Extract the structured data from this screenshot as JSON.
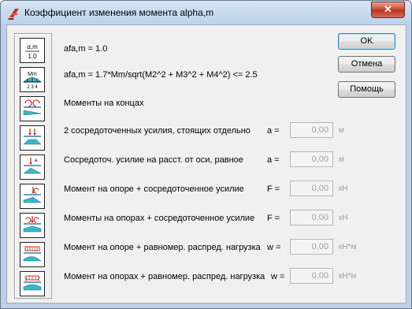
{
  "window": {
    "title": "Коэффициент изменения момента alpha,m",
    "close_label": "✕"
  },
  "formulas": {
    "f1": "afa,m = 1.0",
    "f2": "afa,m = 1.7*Mm/sqrt(M2^2 + M3^2 + M4^2) <= 2.5"
  },
  "icon_texts": {
    "alpha_top": "α,m",
    "alpha_bottom": "1.0",
    "mm_top": "Mm",
    "mm_bottom": "2 3 4"
  },
  "rows": [
    {
      "label": "Моменты на концах"
    },
    {
      "label": "2 сосредоточенных усилия, стоящих отдельно",
      "var": "a =",
      "value": "0,00",
      "unit": "м"
    },
    {
      "label": "Сосредоточ. усилие на расст. от оси, равное",
      "var": "a =",
      "value": "0,00",
      "unit": "м"
    },
    {
      "label": "Момент на опоре + сосредоточенное усилие",
      "var": "F =",
      "value": "0,00",
      "unit": "кН"
    },
    {
      "label": "Моменты на опорах + сосредоточенное усилие",
      "var": "F =",
      "value": "0,00",
      "unit": "кН"
    },
    {
      "label": "Момент на опоре + равномер. распред. нагрузка",
      "var": "w =",
      "value": "0,00",
      "unit": "кН*м"
    },
    {
      "label": "Момент на опорах + равномер. распред. нагрузка",
      "var": "w =",
      "value": "0,00",
      "unit": "кН*м"
    }
  ],
  "buttons": {
    "ok": "OK",
    "cancel": "Отмена",
    "help": "Помощь"
  },
  "colors": {
    "icon_red": "#c0392b",
    "icon_blue": "#2f7fb3",
    "icon_cyan": "#3fb4c9"
  }
}
